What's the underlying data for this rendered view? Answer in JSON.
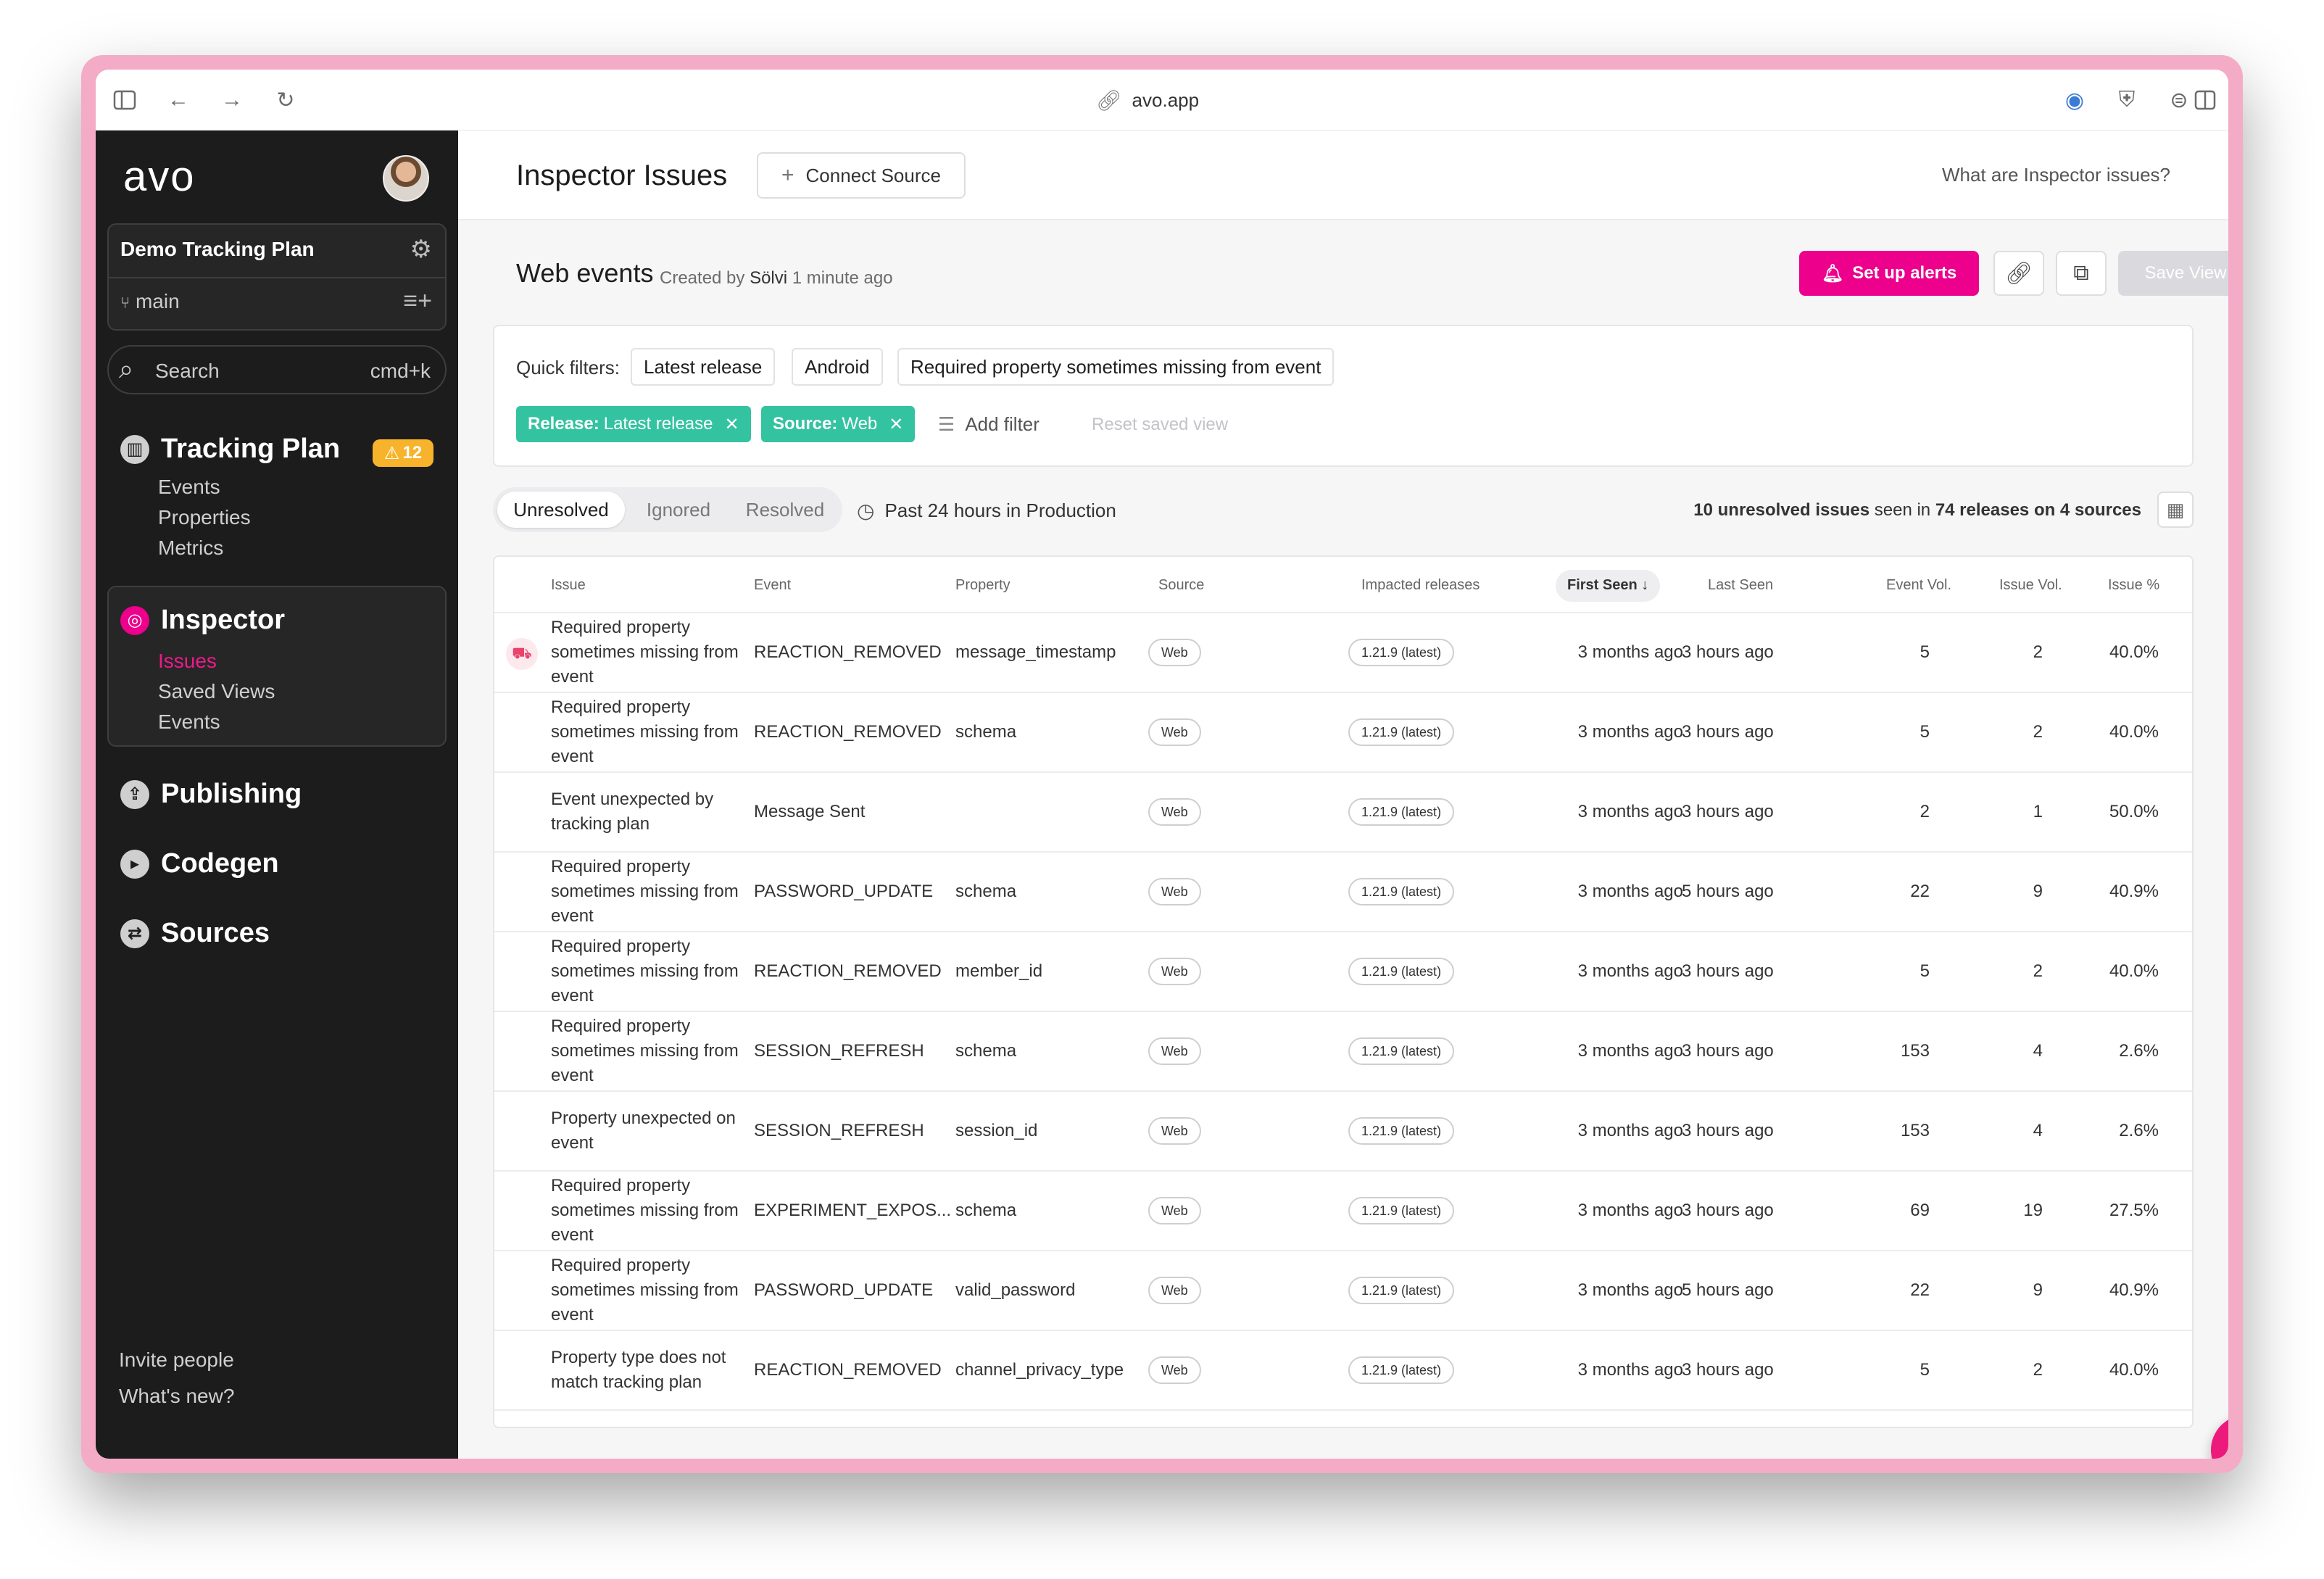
{
  "browser": {
    "url": "avo.app"
  },
  "sidebar": {
    "logo": "avo",
    "plan_name": "Demo Tracking Plan",
    "branch": "main",
    "search_label": "Search",
    "search_shortcut": "cmd+k",
    "tracking_plan": {
      "label": "Tracking Plan",
      "badge": "12",
      "items": [
        "Events",
        "Properties",
        "Metrics"
      ]
    },
    "inspector": {
      "label": "Inspector",
      "items": [
        "Issues",
        "Saved Views",
        "Events"
      ]
    },
    "publishing": "Publishing",
    "codegen": "Codegen",
    "sources": "Sources",
    "invite": "Invite people",
    "whats_new": "What's new?"
  },
  "topbar": {
    "title": "Inspector Issues",
    "connect_source": "Connect Source",
    "help_link": "What are Inspector issues?"
  },
  "view": {
    "title": "Web events",
    "meta_prefix": "Created by",
    "author": "Sölvi",
    "time": "1 minute ago",
    "alerts_button": "Set up alerts",
    "save_button": "Save View"
  },
  "filters": {
    "quick_label": "Quick filters:",
    "quick": [
      "Latest release",
      "Android",
      "Required property sometimes missing from event"
    ],
    "active": [
      {
        "key": "Release:",
        "value": "Latest release"
      },
      {
        "key": "Source:",
        "value": "Web"
      }
    ],
    "add_filter": "Add filter",
    "reset": "Reset saved view"
  },
  "tabs": [
    "Unresolved",
    "Ignored",
    "Resolved"
  ],
  "time_range": "Past 24 hours in Production",
  "summary": {
    "count": "10 unresolved issues",
    "seen_in": "seen in",
    "releases": "74 releases on 4 sources"
  },
  "table": {
    "headers": {
      "issue": "Issue",
      "event": "Event",
      "property": "Property",
      "source": "Source",
      "impacted": "Impacted releases",
      "first_seen": "First Seen ↓",
      "last_seen": "Last Seen",
      "event_vol": "Event Vol.",
      "issue_vol": "Issue Vol.",
      "issue_pct": "Issue %"
    },
    "rows": [
      {
        "issue": "Required property sometimes missing from event",
        "event": "REACTION_REMOVED",
        "property": "message_timestamp",
        "source": "Web",
        "release": "1.21.9 (latest)",
        "first_seen": "3 months ago",
        "last_seen": "3 hours ago",
        "event_vol": "5",
        "issue_vol": "2",
        "issue_pct": "40.0%"
      },
      {
        "issue": "Required property sometimes missing from event",
        "event": "REACTION_REMOVED",
        "property": "schema",
        "source": "Web",
        "release": "1.21.9 (latest)",
        "first_seen": "3 months ago",
        "last_seen": "3 hours ago",
        "event_vol": "5",
        "issue_vol": "2",
        "issue_pct": "40.0%"
      },
      {
        "issue": "Event unexpected by tracking plan",
        "event": "Message Sent",
        "property": "",
        "source": "Web",
        "release": "1.21.9 (latest)",
        "first_seen": "3 months ago",
        "last_seen": "3 hours ago",
        "event_vol": "2",
        "issue_vol": "1",
        "issue_pct": "50.0%"
      },
      {
        "issue": "Required property sometimes missing from event",
        "event": "PASSWORD_UPDATE",
        "property": "schema",
        "source": "Web",
        "release": "1.21.9 (latest)",
        "first_seen": "3 months ago",
        "last_seen": "5 hours ago",
        "event_vol": "22",
        "issue_vol": "9",
        "issue_pct": "40.9%"
      },
      {
        "issue": "Required property sometimes missing from event",
        "event": "REACTION_REMOVED",
        "property": "member_id",
        "source": "Web",
        "release": "1.21.9 (latest)",
        "first_seen": "3 months ago",
        "last_seen": "3 hours ago",
        "event_vol": "5",
        "issue_vol": "2",
        "issue_pct": "40.0%"
      },
      {
        "issue": "Required property sometimes missing from event",
        "event": "SESSION_REFRESH",
        "property": "schema",
        "source": "Web",
        "release": "1.21.9 (latest)",
        "first_seen": "3 months ago",
        "last_seen": "3 hours ago",
        "event_vol": "153",
        "issue_vol": "4",
        "issue_pct": "2.6%"
      },
      {
        "issue": "Property unexpected on event",
        "event": "SESSION_REFRESH",
        "property": "session_id",
        "source": "Web",
        "release": "1.21.9 (latest)",
        "first_seen": "3 months ago",
        "last_seen": "3 hours ago",
        "event_vol": "153",
        "issue_vol": "4",
        "issue_pct": "2.6%"
      },
      {
        "issue": "Required property sometimes missing from event",
        "event": "EXPERIMENT_EXPOS...",
        "property": "schema",
        "source": "Web",
        "release": "1.21.9 (latest)",
        "first_seen": "3 months ago",
        "last_seen": "3 hours ago",
        "event_vol": "69",
        "issue_vol": "19",
        "issue_pct": "27.5%"
      },
      {
        "issue": "Required property sometimes missing from event",
        "event": "PASSWORD_UPDATE",
        "property": "valid_password",
        "source": "Web",
        "release": "1.21.9 (latest)",
        "first_seen": "3 months ago",
        "last_seen": "5 hours ago",
        "event_vol": "22",
        "issue_vol": "9",
        "issue_pct": "40.9%"
      },
      {
        "issue": "Property type does not match tracking plan",
        "event": "REACTION_REMOVED",
        "property": "channel_privacy_type",
        "source": "Web",
        "release": "1.21.9 (latest)",
        "first_seen": "3 months ago",
        "last_seen": "3 hours ago",
        "event_vol": "5",
        "issue_vol": "2",
        "issue_pct": "40.0%"
      }
    ]
  },
  "colors": {
    "accent": "#ec008c",
    "filter_chip": "#34c3a0",
    "sidebar_bg": "#1c1c1c",
    "warning": "#f7b32b"
  },
  "icons": {
    "chat_launcher": "chat-icon"
  }
}
